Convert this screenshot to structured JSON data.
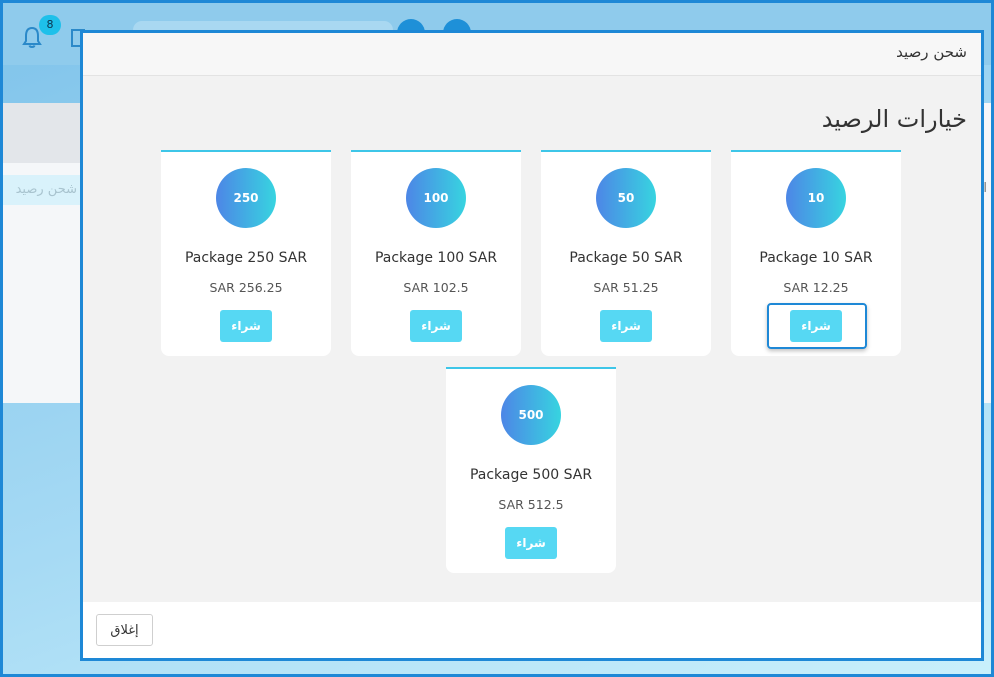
{
  "background": {
    "notification_count": "8",
    "tab_label": "شحن رصيد",
    "right_fragment": "ا"
  },
  "modal": {
    "title": "شحن رصيد",
    "section_title": "خيارات الرصيد",
    "close_label": "إغلاق",
    "packages": [
      {
        "amount": "10",
        "name": "Package 10 SAR",
        "price": "SAR 12.25",
        "buy_label": "شراء"
      },
      {
        "amount": "50",
        "name": "Package 50 SAR",
        "price": "SAR 51.25",
        "buy_label": "شراء"
      },
      {
        "amount": "100",
        "name": "Package 100 SAR",
        "price": "SAR 102.5",
        "buy_label": "شراء"
      },
      {
        "amount": "250",
        "name": "Package 250 SAR",
        "price": "SAR 256.25",
        "buy_label": "شراء"
      },
      {
        "amount": "500",
        "name": "Package 500 SAR",
        "price": "SAR 512.5",
        "buy_label": "شراء"
      }
    ]
  },
  "colors": {
    "accent": "#1e88d6",
    "buy_button": "#56d8f3",
    "circle_gradient_start": "#4d86e6",
    "circle_gradient_end": "#37d4e0"
  }
}
